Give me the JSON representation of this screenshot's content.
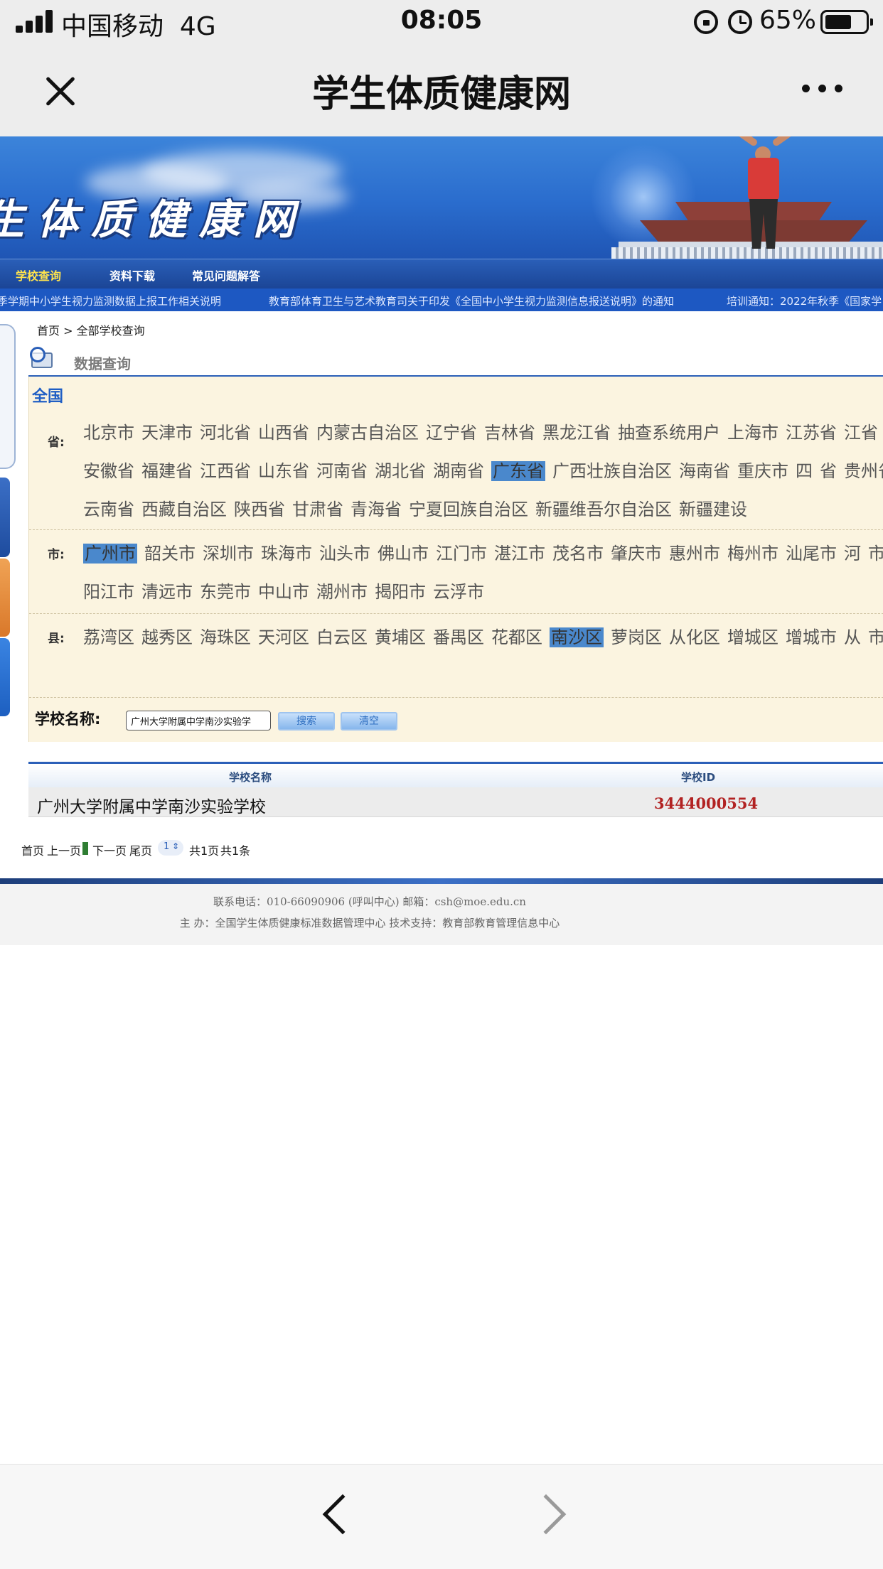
{
  "status": {
    "carrier": "中国移动",
    "network": "4G",
    "time": "08:05",
    "battery": "65%"
  },
  "nav": {
    "title": "学生体质健康网"
  },
  "banner": {
    "logo": "生体质健康网"
  },
  "menu": [
    "学校查询",
    "资料下载",
    "常见问题解答"
  ],
  "ticker": [
    "季学期中小学生视力监测数据上报工作相关说明",
    "教育部体育卫生与艺术教育司关于印发《全国中小学生视力监测信息报送说明》的通知",
    "培训通知：2022年秋季《国家学"
  ],
  "breadcrumb": "首页 > 全部学校查询",
  "query": {
    "title": "数据查询",
    "nation": "全国",
    "province_label": "省:",
    "provinces": [
      "北京市",
      "天津市",
      "河北省",
      "山西省",
      "内蒙古自治区",
      "辽宁省",
      "吉林省",
      "黑龙江省",
      "抽查系统用户",
      "上海市",
      "江苏省",
      "江省",
      "安徽省",
      "福建省",
      "江西省",
      "山东省",
      "河南省",
      "湖北省",
      "湖南省",
      "广东省",
      "广西壮族自治区",
      "海南省",
      "重庆市",
      "四",
      "省",
      "贵州省",
      "云南省",
      "西藏自治区",
      "陕西省",
      "甘肃省",
      "青海省",
      "宁夏回族自治区",
      "新疆维吾尔自治区",
      "新疆建设"
    ],
    "city_label": "市:",
    "cities": [
      "广州市",
      "韶关市",
      "深圳市",
      "珠海市",
      "汕头市",
      "佛山市",
      "江门市",
      "湛江市",
      "茂名市",
      "肇庆市",
      "惠州市",
      "梅州市",
      "汕尾市",
      "河",
      "市",
      "阳江市",
      "清远市",
      "东莞市",
      "中山市",
      "潮州市",
      "揭阳市",
      "云浮市"
    ],
    "county_label": "县:",
    "counties": [
      "荔湾区",
      "越秀区",
      "海珠区",
      "天河区",
      "白云区",
      "黄埔区",
      "番禺区",
      "花都区",
      "南沙区",
      "萝岗区",
      "从化区",
      "增城区",
      "增城市",
      "从",
      "市"
    ],
    "school_label": "学校名称:",
    "school_value": "广州大学附属中学南沙实验学",
    "search_label": "搜索",
    "clear_label": "清空"
  },
  "results": {
    "col_name": "学校名称",
    "col_id": "学校ID",
    "rows": [
      {
        "name": "广州大学附属中学南沙实验学校",
        "id": "3444000554"
      }
    ]
  },
  "pager": {
    "first": "首页",
    "prev": "上一页",
    "next": "下一页",
    "last": "尾页",
    "page": "1",
    "pages": "共1页",
    "records": "共1条"
  },
  "footer": {
    "line1": "联系电话：010-66090906 (呼叫中心) 邮箱：csh@moe.edu.cn",
    "line2": "主 办：全国学生体质健康标准数据管理中心 技术支持：教育部教育管理信息中心"
  },
  "colors": {
    "accent": "#2a5fb8",
    "panel": "#fbf4e0",
    "selected": "#4a88cc",
    "id_red": "#b22222"
  }
}
